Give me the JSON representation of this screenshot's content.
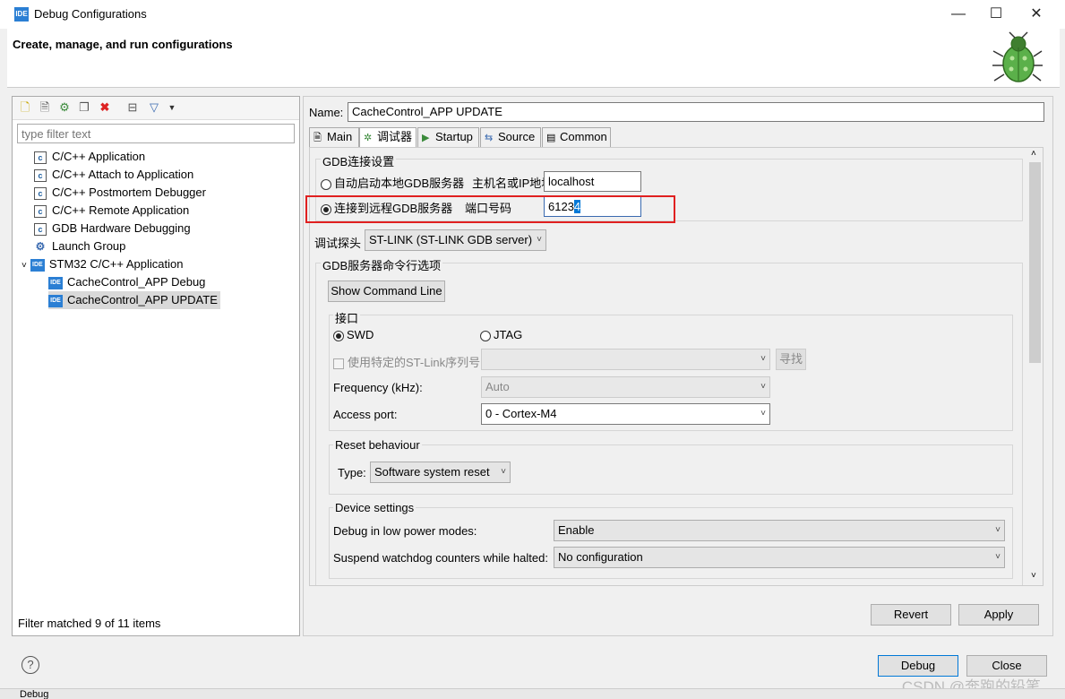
{
  "window": {
    "title": "Debug Configurations",
    "minimize": "—",
    "maximize": "☐",
    "close": "✕"
  },
  "header": {
    "title": "Create, manage, and run configurations"
  },
  "left": {
    "filter_placeholder": "type filter text",
    "items": [
      {
        "label": "C/C++ Application",
        "icon": "c-icon"
      },
      {
        "label": "C/C++ Attach to Application",
        "icon": "c-icon"
      },
      {
        "label": "C/C++ Postmortem Debugger",
        "icon": "c-icon"
      },
      {
        "label": "C/C++ Remote Application",
        "icon": "c-icon"
      },
      {
        "label": "GDB Hardware Debugging",
        "icon": "c-icon"
      },
      {
        "label": "Launch Group",
        "icon": "launch-icon"
      },
      {
        "label": "STM32 C/C++ Application",
        "icon": "ide-icon"
      },
      {
        "label": "CacheControl_APP Debug",
        "icon": "ide-icon"
      },
      {
        "label": "CacheControl_APP UPDATE",
        "icon": "ide-icon"
      }
    ],
    "status": "Filter matched 9 of 11 items"
  },
  "right": {
    "name_label": "Name:",
    "name_value": "CacheControl_APP UPDATE",
    "tabs": [
      "Main",
      "调试器",
      "Startup",
      "Source",
      "Common"
    ],
    "gdb_group": "GDB连接设置",
    "radio_local": "自动启动本地GDB服务器",
    "host_label": "主机名或IP地址",
    "host_value": "localhost",
    "radio_remote": "连接到远程GDB服务器",
    "port_label": "端口号码",
    "port_value_plain": "6123",
    "port_value_selected": "4",
    "probe_label": "调试探头",
    "probe_value": "ST-LINK (ST-LINK GDB server)",
    "gdb_cmd_group": "GDB服务器命令行选项",
    "show_cmd_btn": "Show Command Line",
    "iface_group": "接口",
    "swd": "SWD",
    "jtag": "JTAG",
    "stlink_sn": "使用特定的ST-Link序列号",
    "find_btn": "寻找",
    "freq_label": "Frequency (kHz):",
    "freq_value": "Auto",
    "access_label": "Access port:",
    "access_value": "0 - Cortex-M4",
    "reset_group": "Reset behaviour",
    "type_label": "Type:",
    "type_value": "Software system reset",
    "device_group": "Device settings",
    "lowpower_label": "Debug in low power modes:",
    "lowpower_value": "Enable",
    "watchdog_label": "Suspend watchdog counters while halted:",
    "watchdog_value": "No configuration",
    "revert_btn": "Revert",
    "apply_btn": "Apply"
  },
  "footer": {
    "debug_btn": "Debug",
    "close_btn": "Close",
    "help": "?"
  },
  "watermark": "CSDN @奔跑的铅笔。",
  "taskbar": {
    "item": "Debug"
  }
}
